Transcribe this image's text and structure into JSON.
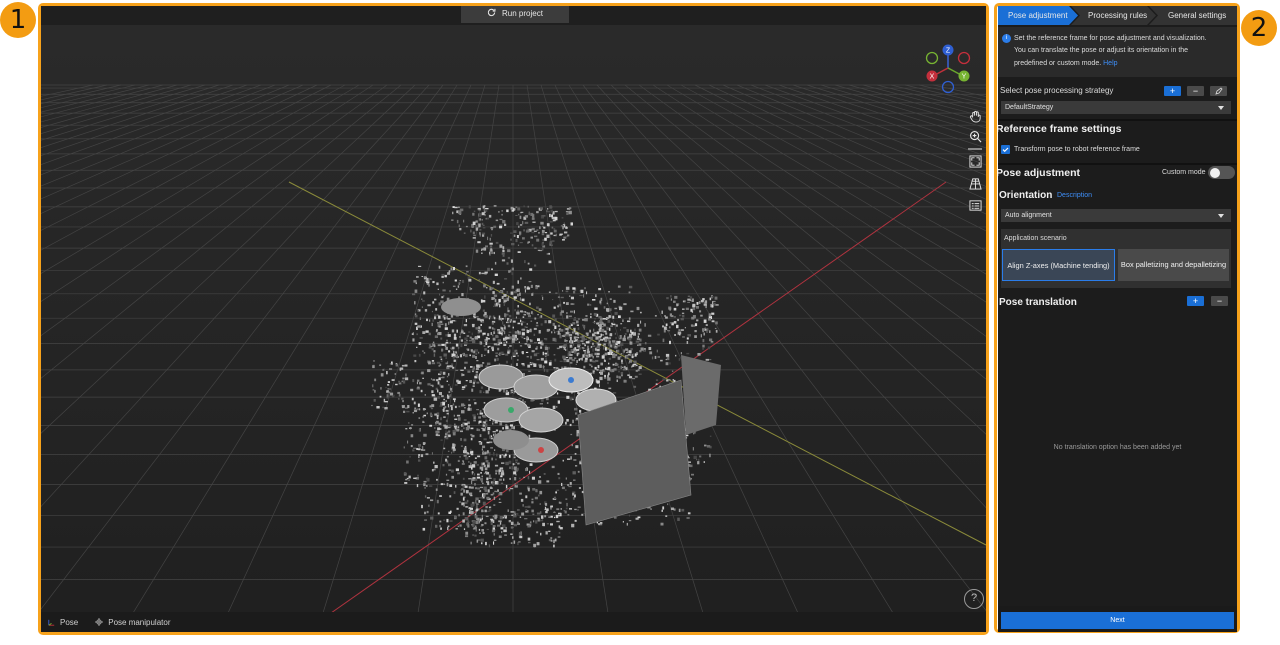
{
  "badges": {
    "one": "1",
    "two": "2"
  },
  "viewer": {
    "run_label": "Run project",
    "legend": {
      "pose": "Pose",
      "manipulator": "Pose manipulator"
    },
    "axes": {
      "z": "Z",
      "x": "X",
      "y": "Y"
    },
    "help": "?"
  },
  "panel": {
    "tabs": {
      "t1": "Pose adjustment",
      "t2": "Processing rules",
      "t3": "General settings"
    },
    "info": {
      "line1": "Set the reference frame for pose adjustment and visualization.",
      "line2": "You can translate the pose or adjust its orientation in the",
      "line3": "predefined or custom mode.",
      "help_link": "Help"
    },
    "strategy": {
      "label": "Select pose processing strategy",
      "value": "DefaultStrategy"
    },
    "ref_frame": {
      "title": "Reference frame settings",
      "checkbox_label": "Transform pose to robot reference frame",
      "checked": true
    },
    "pose_adjust": {
      "title": "Pose adjustment",
      "custom_mode_label": "Custom mode",
      "custom_mode_on": false
    },
    "orientation": {
      "title": "Orientation",
      "desc_link": "Description",
      "value": "Auto alignment"
    },
    "scenario": {
      "label": "Application scenario",
      "opt1": "Align Z-axes (Machine tending)",
      "opt2": "Box palletizing and depalletizing"
    },
    "translation": {
      "title": "Pose translation",
      "empty": "No translation option has been added yet"
    },
    "next_label": "Next"
  },
  "colors": {
    "accent": "#1a6fd6",
    "badge": "#f39c12",
    "outline": "#f7a21b",
    "grid_x": "#b0333f",
    "grid_y": "#8a8a3a"
  }
}
